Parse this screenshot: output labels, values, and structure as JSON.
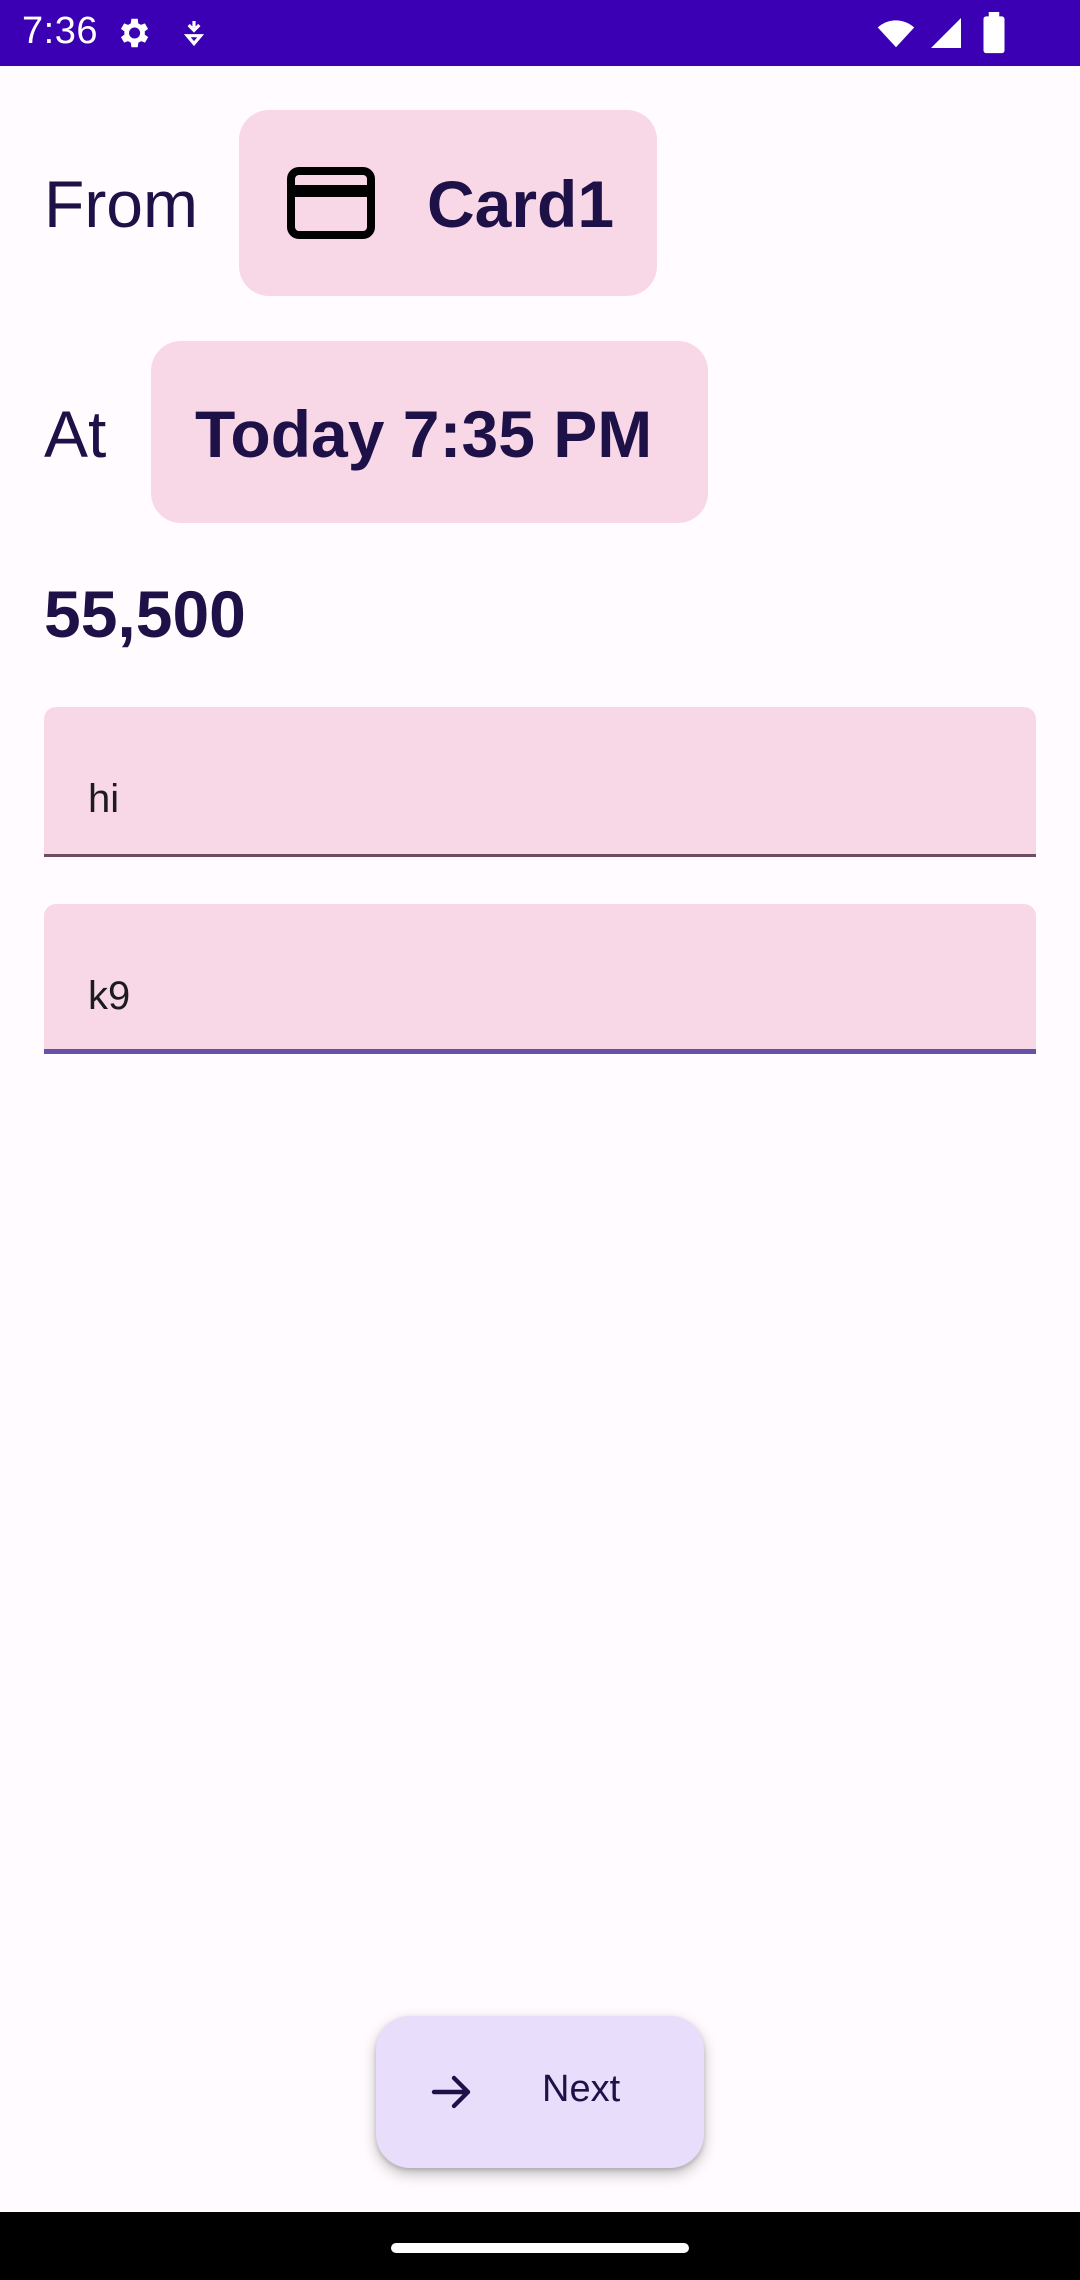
{
  "status_bar": {
    "time": "7:36",
    "icons": [
      "settings-icon",
      "notification-icon",
      "wifi-icon",
      "signal-icon",
      "battery-icon"
    ]
  },
  "from_row": {
    "label": "From",
    "card_icon": "credit-card-icon",
    "card_name": "Card1"
  },
  "at_row": {
    "label": "At",
    "datetime": "Today 7:35 PM"
  },
  "amount": "55,500",
  "fields": [
    {
      "value": "hi"
    },
    {
      "value": "k9"
    }
  ],
  "fab": {
    "icon": "arrow-forward-icon",
    "label": "Next"
  },
  "colors": {
    "status_bar": "#3b00b3",
    "background": "#fffbfe",
    "chip": "#f8d8e7",
    "text": "#1d1148",
    "fab": "#e8defb",
    "focus_line": "#6552ab"
  }
}
